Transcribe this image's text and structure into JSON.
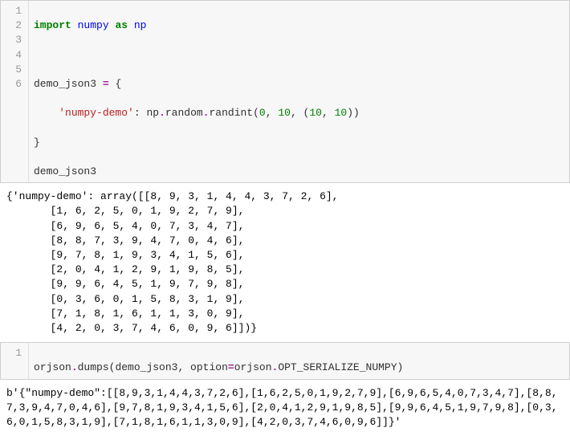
{
  "cell1": {
    "lines": [
      "1",
      "2",
      "3",
      "4",
      "5",
      "6"
    ],
    "l1_import": "import",
    "l1_numpy": "numpy",
    "l1_as": "as",
    "l1_np": "np",
    "l3_demo": "demo_json3 ",
    "l3_eq": "=",
    "l3_brace": " {",
    "l4_indent": "    ",
    "l4_key": "'numpy-demo'",
    "l4_colon": ": np",
    "l4_dot1": ".",
    "l4_random": "random",
    "l4_dot2": ".",
    "l4_randint": "randint",
    "l4_open": "(",
    "l4_a0": "0",
    "l4_c1": ", ",
    "l4_a1": "10",
    "l4_c2": ", (",
    "l4_a2": "10",
    "l4_c3": ", ",
    "l4_a3": "10",
    "l4_close": "))",
    "l5_brace": "}",
    "l6_demo": "demo_json3"
  },
  "out1": "{'numpy-demo': array([[8, 9, 3, 1, 4, 4, 3, 7, 2, 6],\n       [1, 6, 2, 5, 0, 1, 9, 2, 7, 9],\n       [6, 9, 6, 5, 4, 0, 7, 3, 4, 7],\n       [8, 8, 7, 3, 9, 4, 7, 0, 4, 6],\n       [9, 7, 8, 1, 9, 3, 4, 1, 5, 6],\n       [2, 0, 4, 1, 2, 9, 1, 9, 8, 5],\n       [9, 9, 6, 4, 5, 1, 9, 7, 9, 8],\n       [0, 3, 6, 0, 1, 5, 8, 3, 1, 9],\n       [7, 1, 8, 1, 6, 1, 1, 3, 0, 9],\n       [4, 2, 0, 3, 7, 4, 6, 0, 9, 6]])}",
  "cell2": {
    "line": "1",
    "orjson": "orjson",
    "dot1": ".",
    "dumps": "dumps",
    "open": "(demo_json3, option",
    "eq": "=",
    "orjson2": "orjson",
    "dot2": ".",
    "opt": "OPT_SERIALIZE_NUMPY",
    "close": ")"
  },
  "out2": "b'{\"numpy-demo\":[[8,9,3,1,4,4,3,7,2,6],[1,6,2,5,0,1,9,2,7,9],[6,9,6,5,4,0,7,3,4,7],[8,8,7,3,9,4,7,0,4,6],[9,7,8,1,9,3,4,1,5,6],[2,0,4,1,2,9,1,9,8,5],[9,9,6,4,5,1,9,7,9,8],[0,3,6,0,1,5,8,3,1,9],[7,1,8,1,6,1,1,3,0,9],[4,2,0,3,7,4,6,0,9,6]]}'"
}
